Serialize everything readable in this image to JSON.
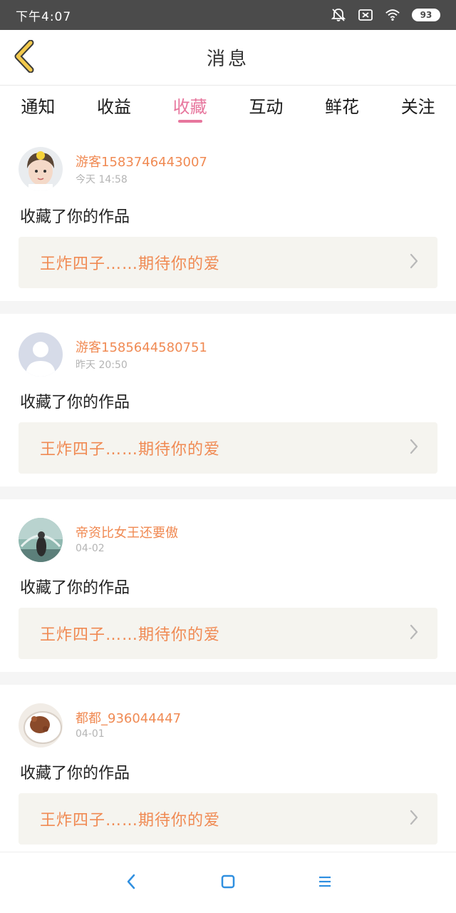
{
  "status_bar": {
    "time": "下午4:07",
    "battery": "93"
  },
  "header": {
    "title": "消息"
  },
  "tabs": [
    {
      "label": "通知",
      "active": false
    },
    {
      "label": "收益",
      "active": false
    },
    {
      "label": "收藏",
      "active": true
    },
    {
      "label": "互动",
      "active": false
    },
    {
      "label": "鲜花",
      "active": false
    },
    {
      "label": "关注",
      "active": false
    }
  ],
  "items": [
    {
      "username": "游客1583746443007",
      "time": "今天 14:58",
      "action": "收藏了你的作品",
      "work_title": "王炸四子……期待你的爱"
    },
    {
      "username": "游客1585644580751",
      "time": "昨天 20:50",
      "action": "收藏了你的作品",
      "work_title": "王炸四子……期待你的爱"
    },
    {
      "username": "帝资比女王还要傲",
      "time": "04-02",
      "action": "收藏了你的作品",
      "work_title": "王炸四子……期待你的爱"
    },
    {
      "username": "都都_936044447",
      "time": "04-01",
      "action": "收藏了你的作品",
      "work_title": "王炸四子……期待你的爱"
    }
  ],
  "colors": {
    "accent": "#e7769d",
    "orange": "#f08a53",
    "nav_blue": "#2f8fe0",
    "back_yellow": "#f2c94c"
  },
  "icons": {
    "back": "chevron-left-icon",
    "item_arrow": "chevron-right-icon",
    "nav_back": "nav-back-icon",
    "nav_home": "nav-home-icon",
    "nav_menu": "nav-menu-icon"
  }
}
